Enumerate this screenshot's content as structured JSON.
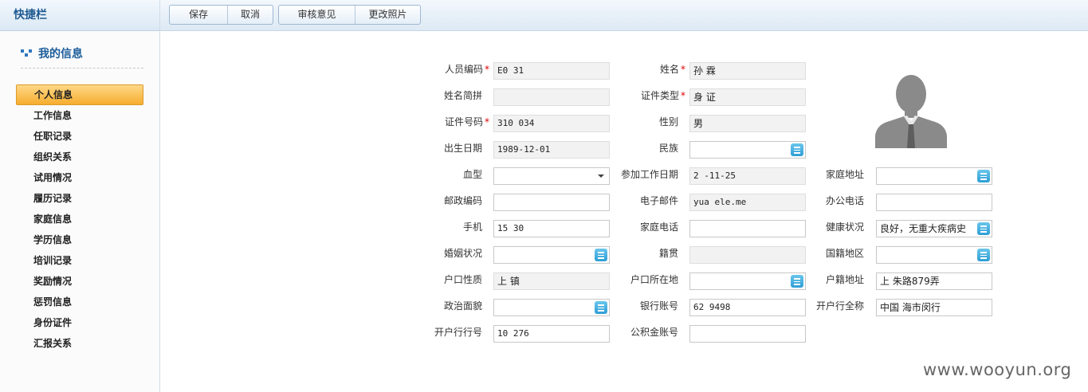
{
  "sidebar": {
    "title": "快捷栏",
    "section": "我的信息",
    "items": [
      "个人信息",
      "工作信息",
      "任职记录",
      "组织关系",
      "试用情况",
      "履历记录",
      "家庭信息",
      "学历信息",
      "培训记录",
      "奖励情况",
      "惩罚信息",
      "身份证件",
      "汇报关系"
    ],
    "active_index": 0
  },
  "toolbar": {
    "save": "保存",
    "cancel": "取消",
    "review": "审核意见",
    "change_photo": "更改照片"
  },
  "form": {
    "emp_code": {
      "label": "人员编码",
      "value": "E0    31"
    },
    "name": {
      "label": "姓名",
      "value": "孙    霖"
    },
    "pinyin": {
      "label": "姓名简拼",
      "value": ""
    },
    "id_type": {
      "label": "证件类型",
      "value": "身   证"
    },
    "id_no": {
      "label": "证件号码",
      "value": "310            034"
    },
    "gender": {
      "label": "性别",
      "value": "男"
    },
    "birth": {
      "label": "出生日期",
      "value": "1989-12-01"
    },
    "ethnic": {
      "label": "民族",
      "value": ""
    },
    "blood": {
      "label": "血型",
      "value": ""
    },
    "work_date": {
      "label": "参加工作日期",
      "value": "2   -11-25"
    },
    "home_addr": {
      "label": "家庭地址",
      "value": ""
    },
    "postcode": {
      "label": "邮政编码",
      "value": ""
    },
    "email": {
      "label": "电子邮件",
      "value": "yua        ele.me"
    },
    "office_tel": {
      "label": "办公电话",
      "value": ""
    },
    "mobile": {
      "label": "手机",
      "value": "15       30"
    },
    "home_tel": {
      "label": "家庭电话",
      "value": ""
    },
    "health": {
      "label": "健康状况",
      "value": "良好，无重大疾病史"
    },
    "marital": {
      "label": "婚姻状况",
      "value": ""
    },
    "native": {
      "label": "籍贯",
      "value": ""
    },
    "nationality": {
      "label": "国籍地区",
      "value": ""
    },
    "hukou_type": {
      "label": "户口性质",
      "value": "上    镇"
    },
    "hukou_loc": {
      "label": "户口所在地",
      "value": ""
    },
    "hukou_addr": {
      "label": "户籍地址",
      "value": "上              朱路879弄"
    },
    "political": {
      "label": "政治面貌",
      "value": ""
    },
    "bank_acct": {
      "label": "银行账号",
      "value": "62            9498"
    },
    "bank_name": {
      "label": "开户行全称",
      "value": "中国            海市闵行"
    },
    "bank_no": {
      "label": "开户行行号",
      "value": "10        276"
    },
    "fund_acct": {
      "label": "公积金账号",
      "value": ""
    }
  },
  "watermark": "www.wooyun.org"
}
